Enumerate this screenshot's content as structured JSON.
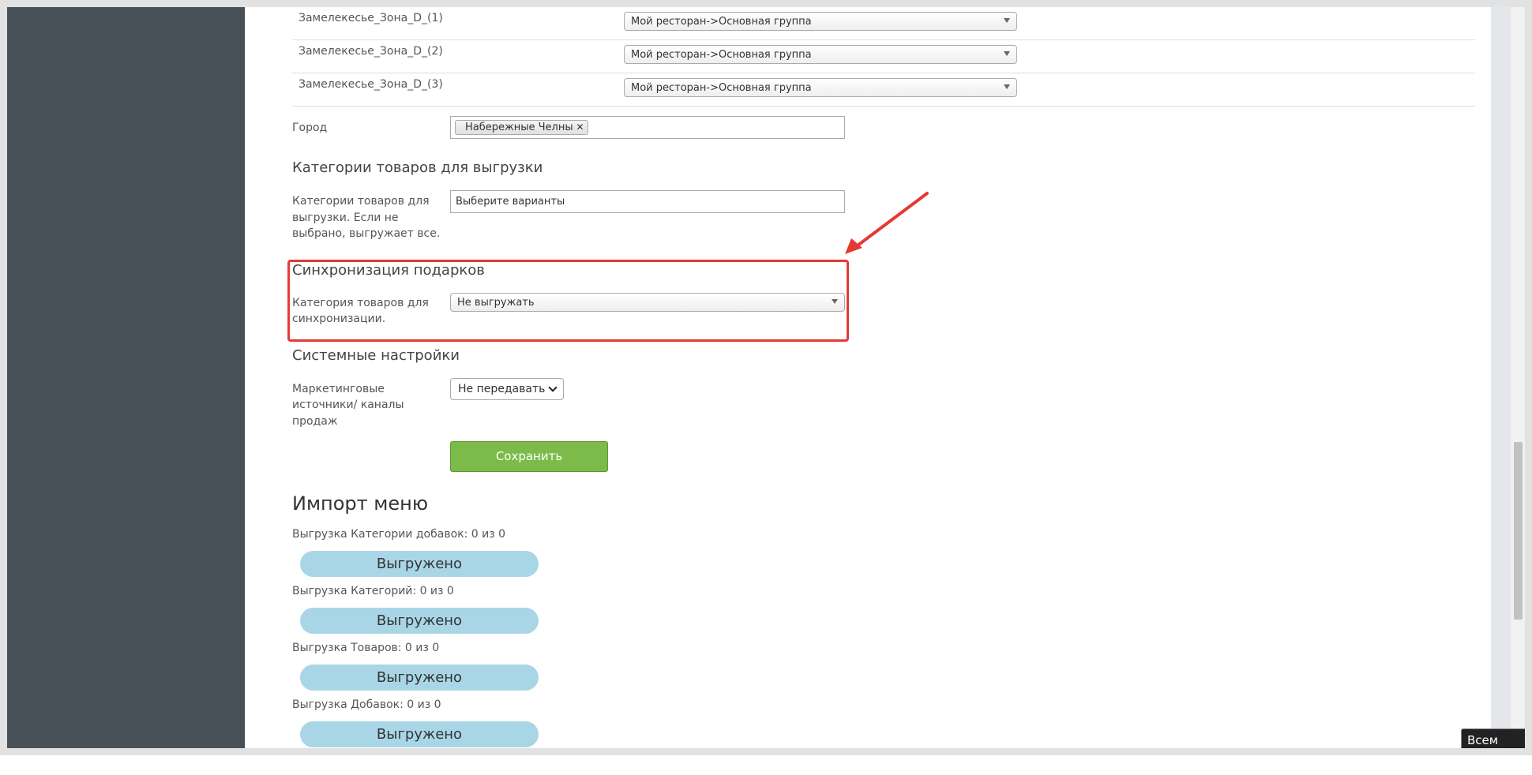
{
  "zones": [
    {
      "label": "Замелекесье_Зона_D_(1)",
      "value": "Мой ресторан->Основная группа"
    },
    {
      "label": "Замелекесье_Зона_D_(2)",
      "value": "Мой ресторан->Основная группа"
    },
    {
      "label": "Замелекесье_Зона_D_(3)",
      "value": "Мой ресторан->Основная группа"
    }
  ],
  "city": {
    "label": "Город",
    "chip": "Набережные Челны",
    "remove_glyph": "✕"
  },
  "upload_categories": {
    "title": "Категории товаров для выгрузки",
    "label_lines": [
      "Категории товаров для",
      "выгрузки. Если не",
      "выбрано, выгружает все."
    ],
    "placeholder": "Выберите варианты"
  },
  "gift_sync": {
    "title": "Синхронизация подарков",
    "label_lines": [
      "Категория товаров для",
      "синхронизации."
    ],
    "value": "Не выгружать"
  },
  "system": {
    "title": "Системные настройки",
    "label_lines": [
      "Маркетинговые",
      "источники/ каналы",
      "продаж"
    ],
    "value": "Не передавать"
  },
  "save_label": "Сохранить",
  "import": {
    "title": "Импорт меню",
    "items": [
      {
        "label": "Выгрузка Категории добавок: 0 из 0",
        "status": "Выгружено"
      },
      {
        "label": "Выгрузка Категорий: 0 из 0",
        "status": "Выгружено"
      },
      {
        "label": "Выгрузка Товаров: 0 из 0",
        "status": "Выгружено"
      },
      {
        "label": "Выгрузка Добавок: 0 из 0",
        "status": "Выгружено"
      }
    ]
  },
  "brand_badge": "Всем Еды",
  "colors": {
    "highlight": "#e53935",
    "save": "#7cbb49",
    "pill": "#a9d6e6",
    "sidebar": "#485157"
  }
}
